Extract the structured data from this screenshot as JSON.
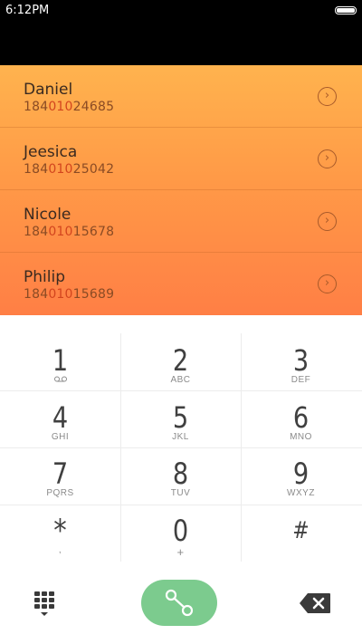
{
  "status_bar": {
    "time": "6:12PM"
  },
  "contacts": [
    {
      "name": "Daniel",
      "number_pre": "184",
      "number_match": "010",
      "number_post": "24685"
    },
    {
      "name": "Jeesica",
      "number_pre": "184",
      "number_match": "010",
      "number_post": "25042"
    },
    {
      "name": "Nicole",
      "number_pre": "184",
      "number_match": "010",
      "number_post": "15678"
    },
    {
      "name": "Philip",
      "number_pre": "184",
      "number_match": "010",
      "number_post": "15689"
    }
  ],
  "detail_glyph": "›",
  "keypad": {
    "keys": [
      {
        "digit": "1",
        "letters": "voicemail-icon"
      },
      {
        "digit": "2",
        "letters": "ABC"
      },
      {
        "digit": "3",
        "letters": "DEF"
      },
      {
        "digit": "4",
        "letters": "GHI"
      },
      {
        "digit": "5",
        "letters": "JKL"
      },
      {
        "digit": "6",
        "letters": "MNO"
      },
      {
        "digit": "7",
        "letters": "PQRS"
      },
      {
        "digit": "8",
        "letters": "TUV"
      },
      {
        "digit": "9",
        "letters": "WXYZ"
      },
      {
        "digit": "*",
        "letters": ","
      },
      {
        "digit": "0",
        "letters": "+"
      },
      {
        "digit": "#",
        "letters": ""
      }
    ]
  },
  "bottom_bar": {
    "dialpad_icon": "dialpad-icon",
    "call_icon": "call-icon",
    "backspace_icon": "backspace-icon"
  },
  "colors": {
    "header_top": "#ffb34e",
    "header_bottom": "#ff7f45",
    "number_highlight": "#d2451e",
    "call_button": "#7ccb8e"
  }
}
